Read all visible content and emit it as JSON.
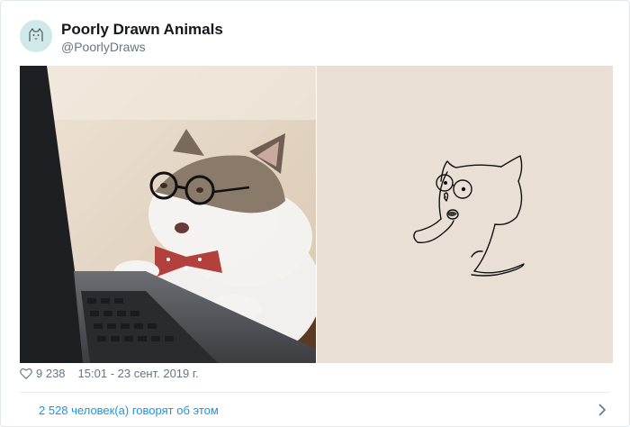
{
  "author": {
    "name": "Poorly Drawn Animals",
    "handle": "@PoorlyDraws"
  },
  "tweet": {
    "likes": "9 238",
    "timestamp": "15:01 - 23 сент. 2019 г."
  },
  "footer": {
    "talking_link": "2 528 человек(а) говорят об этом"
  },
  "icons": {
    "like": "heart-outline-icon",
    "more": "chevron-right-icon"
  },
  "colors": {
    "name": "#14171a",
    "secondary": "#657786",
    "link": "#1b95e0",
    "border": "#e1e8ed"
  }
}
